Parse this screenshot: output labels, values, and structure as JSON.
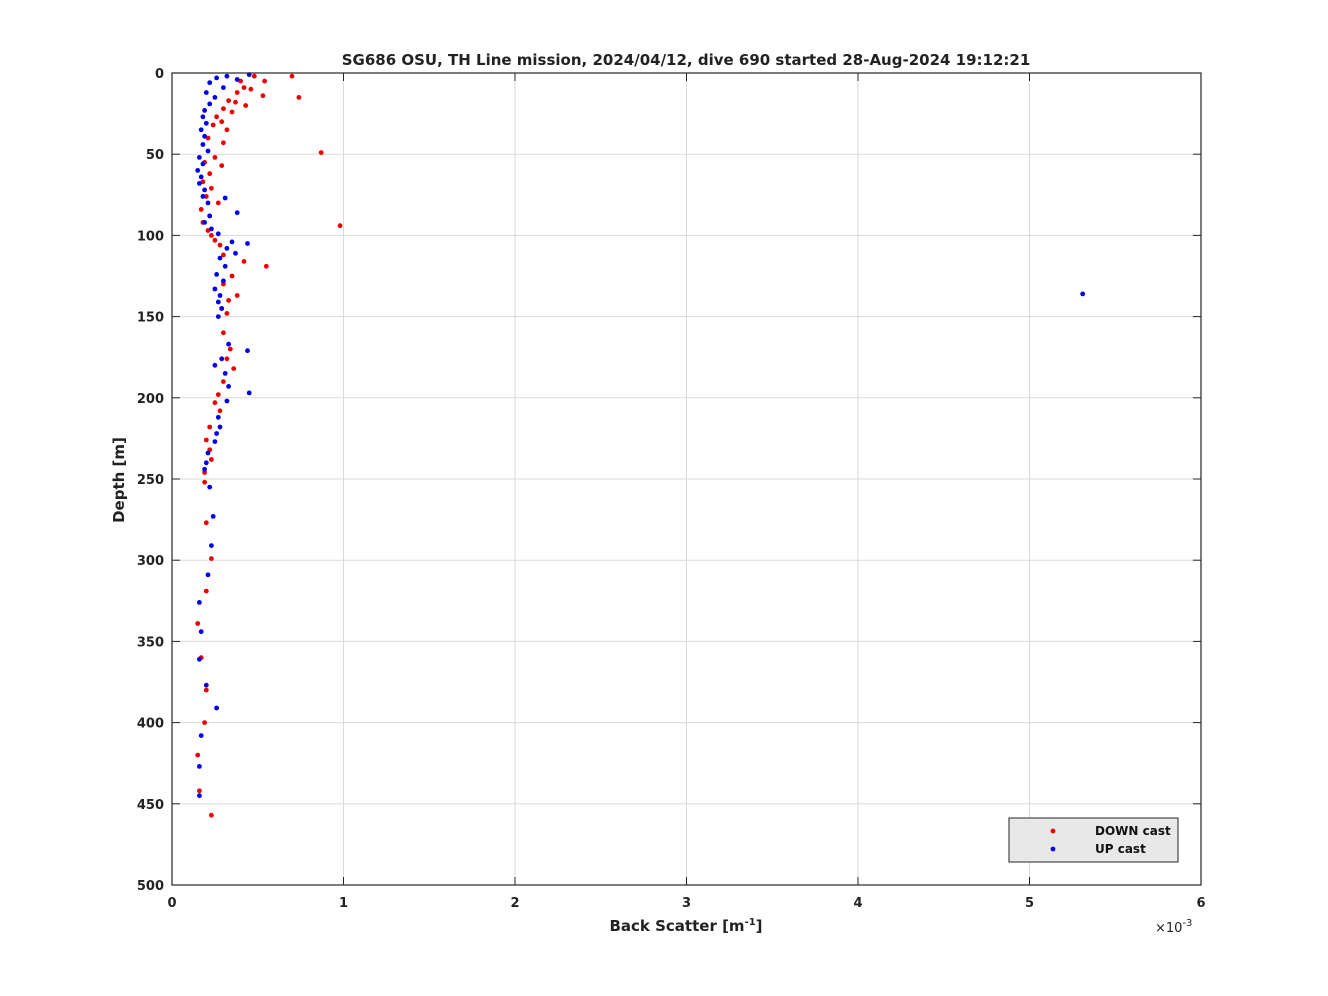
{
  "chart_data": {
    "type": "scatter",
    "title": "SG686 OSU, TH Line mission, 2024/04/12, dive 690 started 28-Aug-2024 19:12:21",
    "xlabel_base": "Back Scatter [m",
    "xlabel_sup": "-1",
    "xlabel_end": "]",
    "ylabel": "Depth [m]",
    "x_multiplier": "×10",
    "x_multiplier_exp": "-3",
    "xlim": [
      0,
      6
    ],
    "ylim": [
      0,
      500
    ],
    "y_reversed": true,
    "grid": true,
    "legend_position": "bottom-right",
    "x_ticks": [
      "0",
      "1",
      "2",
      "3",
      "4",
      "5",
      "6"
    ],
    "y_ticks": [
      "0",
      "50",
      "100",
      "150",
      "200",
      "250",
      "300",
      "350",
      "400",
      "450",
      "500"
    ],
    "series": [
      {
        "name": "DOWN cast",
        "color": "#ee0000",
        "points": [
          [
            0.7,
            2
          ],
          [
            0.54,
            5
          ],
          [
            0.48,
            2
          ],
          [
            0.4,
            5
          ],
          [
            0.42,
            9
          ],
          [
            0.38,
            12
          ],
          [
            0.46,
            10
          ],
          [
            0.53,
            14
          ],
          [
            0.74,
            15
          ],
          [
            0.37,
            18
          ],
          [
            0.43,
            20
          ],
          [
            0.33,
            17
          ],
          [
            0.3,
            22
          ],
          [
            0.35,
            24
          ],
          [
            0.26,
            27
          ],
          [
            0.29,
            30
          ],
          [
            0.24,
            32
          ],
          [
            0.32,
            35
          ],
          [
            0.21,
            40
          ],
          [
            0.3,
            43
          ],
          [
            0.87,
            49
          ],
          [
            0.25,
            52
          ],
          [
            0.19,
            55
          ],
          [
            0.29,
            57
          ],
          [
            0.22,
            62
          ],
          [
            0.18,
            67
          ],
          [
            0.23,
            71
          ],
          [
            0.2,
            76
          ],
          [
            0.27,
            80
          ],
          [
            0.17,
            84
          ],
          [
            0.22,
            88
          ],
          [
            0.18,
            92
          ],
          [
            0.98,
            94
          ],
          [
            0.21,
            97
          ],
          [
            0.23,
            100
          ],
          [
            0.25,
            103
          ],
          [
            0.28,
            106
          ],
          [
            0.3,
            112
          ],
          [
            0.42,
            116
          ],
          [
            0.55,
            119
          ],
          [
            0.35,
            125
          ],
          [
            0.3,
            130
          ],
          [
            0.38,
            137
          ],
          [
            0.33,
            140
          ],
          [
            0.29,
            145
          ],
          [
            0.32,
            148
          ],
          [
            0.3,
            160
          ],
          [
            0.34,
            170
          ],
          [
            0.32,
            176
          ],
          [
            0.36,
            182
          ],
          [
            0.3,
            190
          ],
          [
            0.27,
            198
          ],
          [
            0.25,
            203
          ],
          [
            0.28,
            208
          ],
          [
            0.22,
            218
          ],
          [
            0.2,
            226
          ],
          [
            0.22,
            232
          ],
          [
            0.23,
            238
          ],
          [
            0.19,
            246
          ],
          [
            0.19,
            252
          ],
          [
            0.2,
            277
          ],
          [
            0.23,
            299
          ],
          [
            0.2,
            319
          ],
          [
            0.15,
            339
          ],
          [
            0.17,
            360
          ],
          [
            0.2,
            380
          ],
          [
            0.19,
            400
          ],
          [
            0.15,
            420
          ],
          [
            0.16,
            442
          ],
          [
            0.23,
            457
          ]
        ]
      },
      {
        "name": "UP cast",
        "color": "#0000ee",
        "points": [
          [
            0.45,
            1
          ],
          [
            0.32,
            2
          ],
          [
            0.26,
            3
          ],
          [
            0.38,
            4
          ],
          [
            0.22,
            6
          ],
          [
            0.3,
            9
          ],
          [
            0.2,
            12
          ],
          [
            0.25,
            15
          ],
          [
            0.22,
            19
          ],
          [
            0.19,
            23
          ],
          [
            0.18,
            27
          ],
          [
            0.2,
            31
          ],
          [
            0.17,
            35
          ],
          [
            0.19,
            39
          ],
          [
            0.18,
            44
          ],
          [
            0.21,
            48
          ],
          [
            0.16,
            52
          ],
          [
            0.18,
            56
          ],
          [
            0.15,
            60
          ],
          [
            0.17,
            64
          ],
          [
            0.16,
            68
          ],
          [
            0.19,
            72
          ],
          [
            0.18,
            76
          ],
          [
            0.31,
            77
          ],
          [
            0.21,
            80
          ],
          [
            0.38,
            86
          ],
          [
            0.22,
            88
          ],
          [
            0.19,
            92
          ],
          [
            0.23,
            96
          ],
          [
            0.27,
            99
          ],
          [
            0.35,
            104
          ],
          [
            0.44,
            105
          ],
          [
            0.32,
            108
          ],
          [
            0.37,
            111
          ],
          [
            0.28,
            114
          ],
          [
            0.31,
            119
          ],
          [
            0.26,
            124
          ],
          [
            0.3,
            128
          ],
          [
            0.25,
            133
          ],
          [
            0.28,
            137
          ],
          [
            5.31,
            136
          ],
          [
            0.27,
            141
          ],
          [
            0.29,
            145
          ],
          [
            0.27,
            150
          ],
          [
            0.33,
            167
          ],
          [
            0.44,
            171
          ],
          [
            0.29,
            176
          ],
          [
            0.25,
            180
          ],
          [
            0.31,
            185
          ],
          [
            0.33,
            193
          ],
          [
            0.45,
            197
          ],
          [
            0.32,
            202
          ],
          [
            0.27,
            212
          ],
          [
            0.28,
            218
          ],
          [
            0.26,
            222
          ],
          [
            0.25,
            227
          ],
          [
            0.21,
            234
          ],
          [
            0.2,
            240
          ],
          [
            0.19,
            244
          ],
          [
            0.22,
            255
          ],
          [
            0.24,
            273
          ],
          [
            0.23,
            291
          ],
          [
            0.21,
            309
          ],
          [
            0.16,
            326
          ],
          [
            0.17,
            344
          ],
          [
            0.16,
            361
          ],
          [
            0.2,
            377
          ],
          [
            0.26,
            391
          ],
          [
            0.17,
            408
          ],
          [
            0.16,
            427
          ],
          [
            0.16,
            445
          ]
        ]
      }
    ]
  }
}
